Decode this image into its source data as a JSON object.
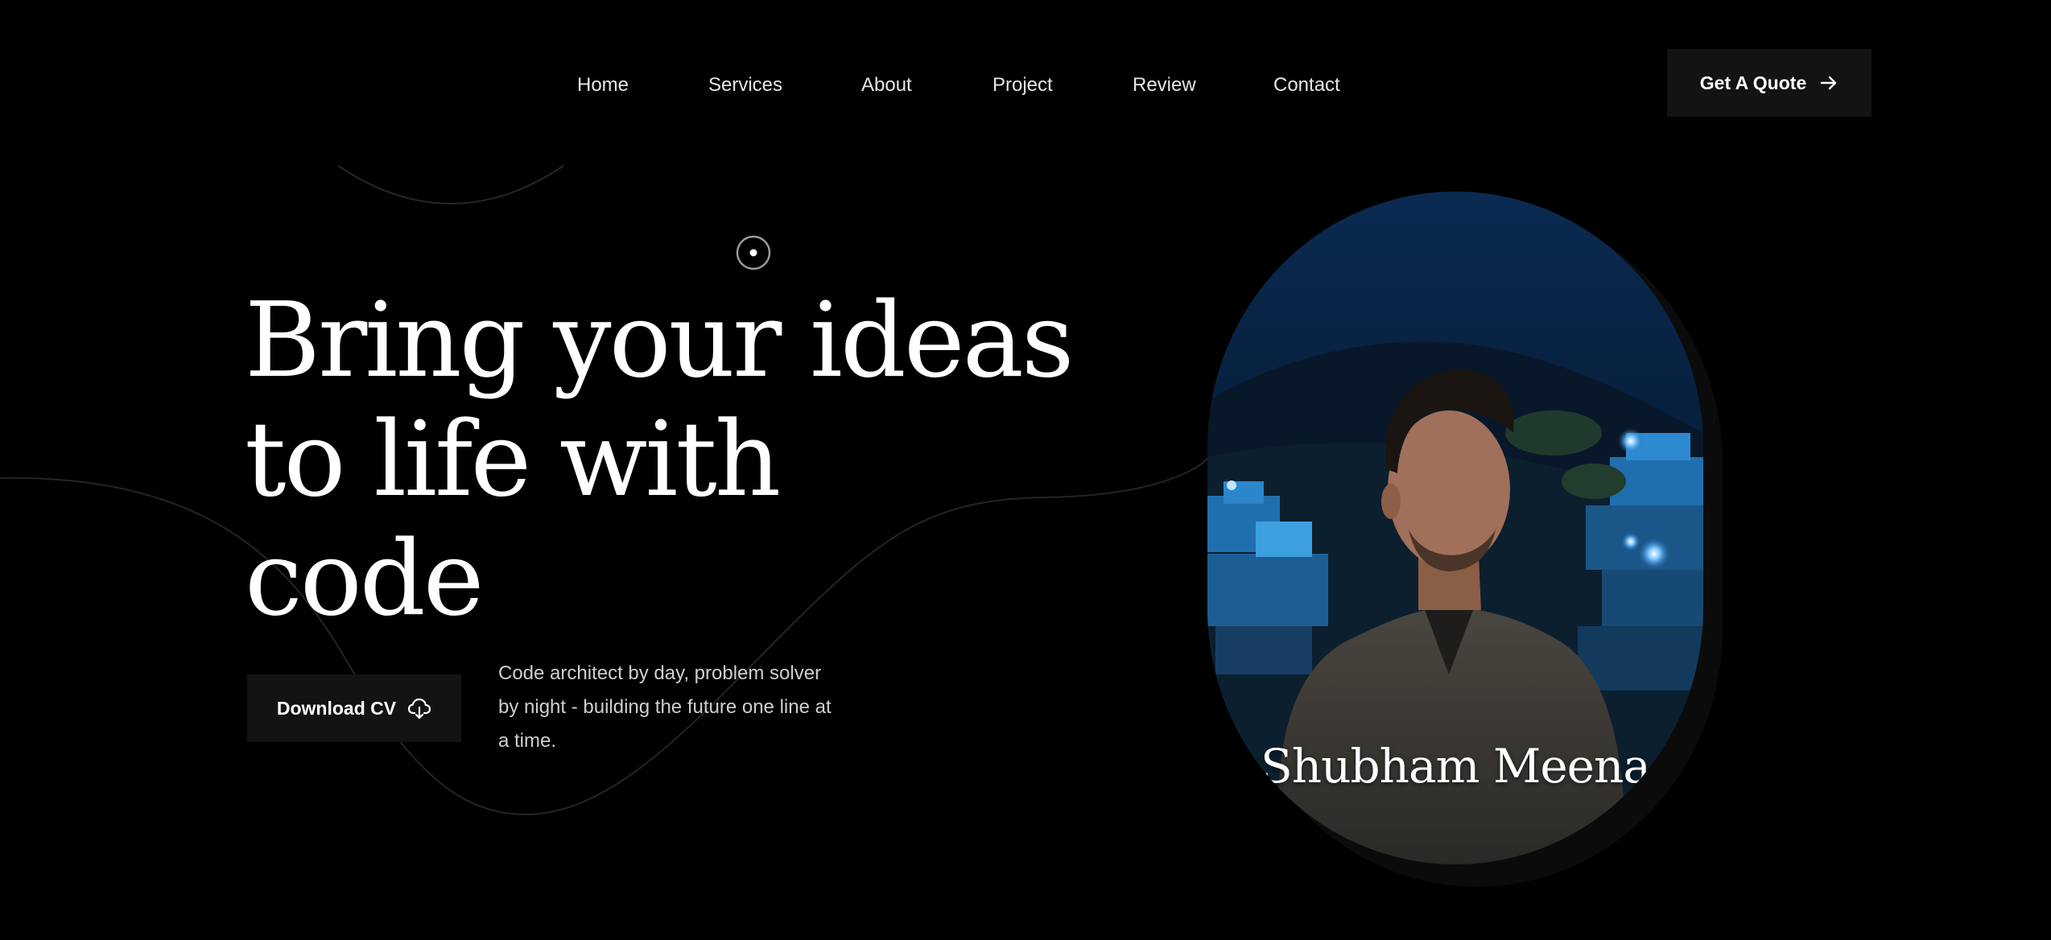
{
  "nav": {
    "items": [
      {
        "label": "Home"
      },
      {
        "label": "Services"
      },
      {
        "label": "About"
      },
      {
        "label": "Project"
      },
      {
        "label": "Review"
      },
      {
        "label": "Contact"
      }
    ],
    "cta_label": "Get A Quote",
    "cta_icon": "arrow-right-icon"
  },
  "hero": {
    "title_lines": [
      "Bring your ideas",
      "to life with",
      "code"
    ],
    "download_label": "Download CV",
    "download_icon": "cloud-download-icon",
    "tagline": "Code architect by day, problem solver by night - building the future one line at a time.",
    "scroll_icon": "scroll-indicator-icon"
  },
  "portrait": {
    "name": "Shubham Meena",
    "image_icon": "profile-photo"
  },
  "colors": {
    "background": "#000000",
    "button_bg": "#131313",
    "text": "#ffffff",
    "muted_text": "#cfcfcf",
    "photo_sky": "#06213f"
  }
}
